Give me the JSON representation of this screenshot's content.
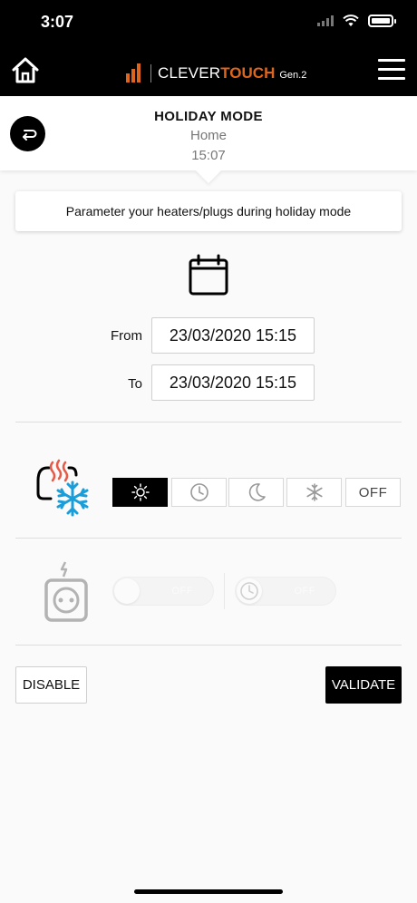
{
  "status_bar": {
    "time": "3:07"
  },
  "navbar": {
    "brand_clever": "CLEVER",
    "brand_touch": "TOUCH",
    "brand_gen": "Gen.2",
    "home_icon": "home-icon",
    "menu_icon": "hamburger-menu-icon"
  },
  "subheader": {
    "title": "HOLIDAY MODE",
    "location": "Home",
    "time": "15:07",
    "back_icon": "back-arrow-icon"
  },
  "info": {
    "text": "Parameter your heaters/plugs during holiday mode"
  },
  "dates": {
    "from_label": "From",
    "from_value": "23/03/2020 15:15",
    "to_label": "To",
    "to_value": "23/03/2020 15:15"
  },
  "heater_modes": {
    "selected": "comfort",
    "options": [
      {
        "id": "comfort",
        "icon": "sun-icon"
      },
      {
        "id": "program",
        "icon": "clock-icon"
      },
      {
        "id": "eco",
        "icon": "moon-icon"
      },
      {
        "id": "frost",
        "icon": "snowflake-icon"
      },
      {
        "id": "off",
        "label": "OFF"
      }
    ]
  },
  "plugs": {
    "disabled": true,
    "toggle_off_label": "OFF",
    "toggle_timer_label": "OFF"
  },
  "actions": {
    "disable_label": "DISABLE",
    "validate_label": "VALIDATE"
  },
  "colors": {
    "brand_orange": "#e0651c",
    "heat_red": "#e65a47",
    "frost_blue": "#1a9ed9"
  }
}
